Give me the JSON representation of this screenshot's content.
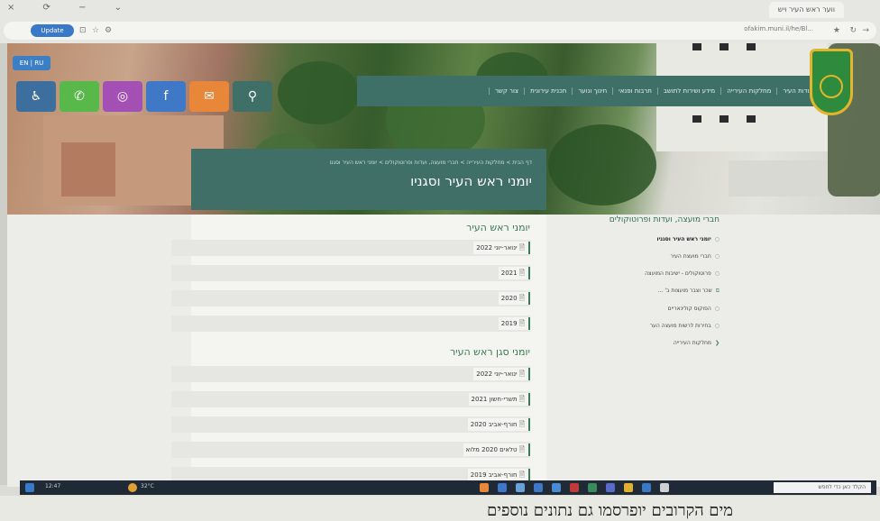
{
  "browser": {
    "tab_title": "ווער ראש העיר ויש",
    "url": "ofakim.muni.il/he/Bl...",
    "profile_label": "Update",
    "window_controls": "× ⟳ − ⌄"
  },
  "site": {
    "lang_tab": "EN | RU",
    "social": [
      {
        "name": "accessibility",
        "glyph": "♿",
        "color": "#3d6f9e"
      },
      {
        "name": "whatsapp",
        "glyph": "✆",
        "color": "#59b84a"
      },
      {
        "name": "instagram",
        "glyph": "◎",
        "color": "#a44fb4"
      },
      {
        "name": "facebook",
        "glyph": "f",
        "color": "#3f78c7"
      },
      {
        "name": "email",
        "glyph": "✉",
        "color": "#e8873a"
      },
      {
        "name": "search",
        "glyph": "⚲",
        "color": "#3e7068"
      }
    ],
    "nav": [
      "אודות העיר",
      "מחלקות העירייה",
      "מידע ושירות לתושב",
      "תרבות ופנאי",
      "חינוך ונוער",
      "תכנית עירונית",
      "צור קשר"
    ],
    "breadcrumb": "דף הבית > מחלקות העירייה > חברי מועצה, ועדות ופרוטוקולים > יומני ראש העיר וסגנו",
    "page_title": "יומני ראש העיר וסגניו",
    "sections": [
      {
        "title": "יומני ראש העיר",
        "items": [
          "ינואר-יוני 2022",
          "2021",
          "2020",
          "2019"
        ]
      },
      {
        "title": "יומני סגן ראש העיר",
        "items": [
          "ינואר-יוני 2022",
          "תשרי-חשון 2021",
          "חורף-אביב 2020",
          "טלאים 2020 מלוא",
          "חורף-אביב 2019"
        ]
      }
    ],
    "sidebar": {
      "title": "חברי מועצה, ועדות ופרוטוקולים",
      "items": [
        {
          "label": "יומני ראש העיר וסגניו",
          "active": true
        },
        {
          "label": "חברי מועצת העיר",
          "active": false
        },
        {
          "label": "פרוטוקולים - ישיבות המועצה",
          "active": false
        },
        {
          "label": "שכר וצבר מועצות ב' ...",
          "active": false
        },
        {
          "label": "הפוקוס קולינאריים",
          "active": false
        },
        {
          "label": "בחירות לרשות מועצה הער",
          "active": false
        },
        {
          "label": "מחלקות העירייה",
          "active": false
        }
      ]
    }
  },
  "taskbar": {
    "search_placeholder": "הקלד כאן כדי לחפש",
    "weather": "32°C",
    "clock": "12:47"
  },
  "scan_caption": "מים הקרובים יופרסמו גם נתונים נוספים"
}
